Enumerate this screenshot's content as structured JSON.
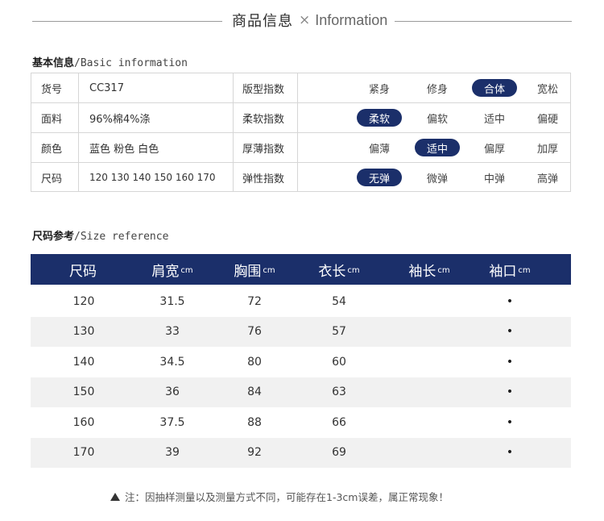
{
  "header": {
    "title_cn": "商品信息",
    "separator": "×",
    "title_en": "Information"
  },
  "basic_section": {
    "title_cn": "基本信息",
    "title_en": "/Basic information"
  },
  "basic_rows": [
    {
      "label": "货号",
      "value": "CC317",
      "index_name": "版型指数",
      "options": [
        "紧身",
        "修身",
        "合体",
        "宽松"
      ],
      "selected": 2
    },
    {
      "label": "面料",
      "value": "96%棉4%涤",
      "index_name": "柔软指数",
      "options": [
        "柔软",
        "偏软",
        "适中",
        "偏硬"
      ],
      "selected": 0
    },
    {
      "label": "颜色",
      "value": "蓝色  粉色  白色",
      "index_name": "厚薄指数",
      "options": [
        "偏薄",
        "适中",
        "偏厚",
        "加厚"
      ],
      "selected": 1
    },
    {
      "label": "尺码",
      "value": "120  130  140  150  160  170",
      "index_name": "弹性指数",
      "options": [
        "无弹",
        "微弹",
        "中弹",
        "高弹"
      ],
      "selected": 0
    }
  ],
  "size_section": {
    "title_cn": "尺码参考",
    "title_en": "/Size reference"
  },
  "size_table": {
    "headers": [
      {
        "label": "尺码",
        "unit": ""
      },
      {
        "label": "肩宽",
        "unit": "cm"
      },
      {
        "label": "胸围",
        "unit": "cm"
      },
      {
        "label": "衣长",
        "unit": "cm"
      },
      {
        "label": "袖长",
        "unit": "cm"
      },
      {
        "label": "袖口",
        "unit": "cm"
      }
    ],
    "rows": [
      [
        "120",
        "31.5",
        "72",
        "54",
        "",
        "•"
      ],
      [
        "130",
        "33",
        "76",
        "57",
        "",
        "•"
      ],
      [
        "140",
        "34.5",
        "80",
        "60",
        "",
        "•"
      ],
      [
        "150",
        "36",
        "84",
        "63",
        "",
        "•"
      ],
      [
        "160",
        "37.5",
        "88",
        "66",
        "",
        "•"
      ],
      [
        "170",
        "39",
        "92",
        "69",
        "",
        "•"
      ]
    ]
  },
  "note": "注：因抽样测量以及测量方式不同，可能存在1-3cm误差，属正常现象！",
  "colors": {
    "navy": "#1b2f6a",
    "row_alt": "#f1f1f1",
    "border": "#d6d6d6"
  }
}
